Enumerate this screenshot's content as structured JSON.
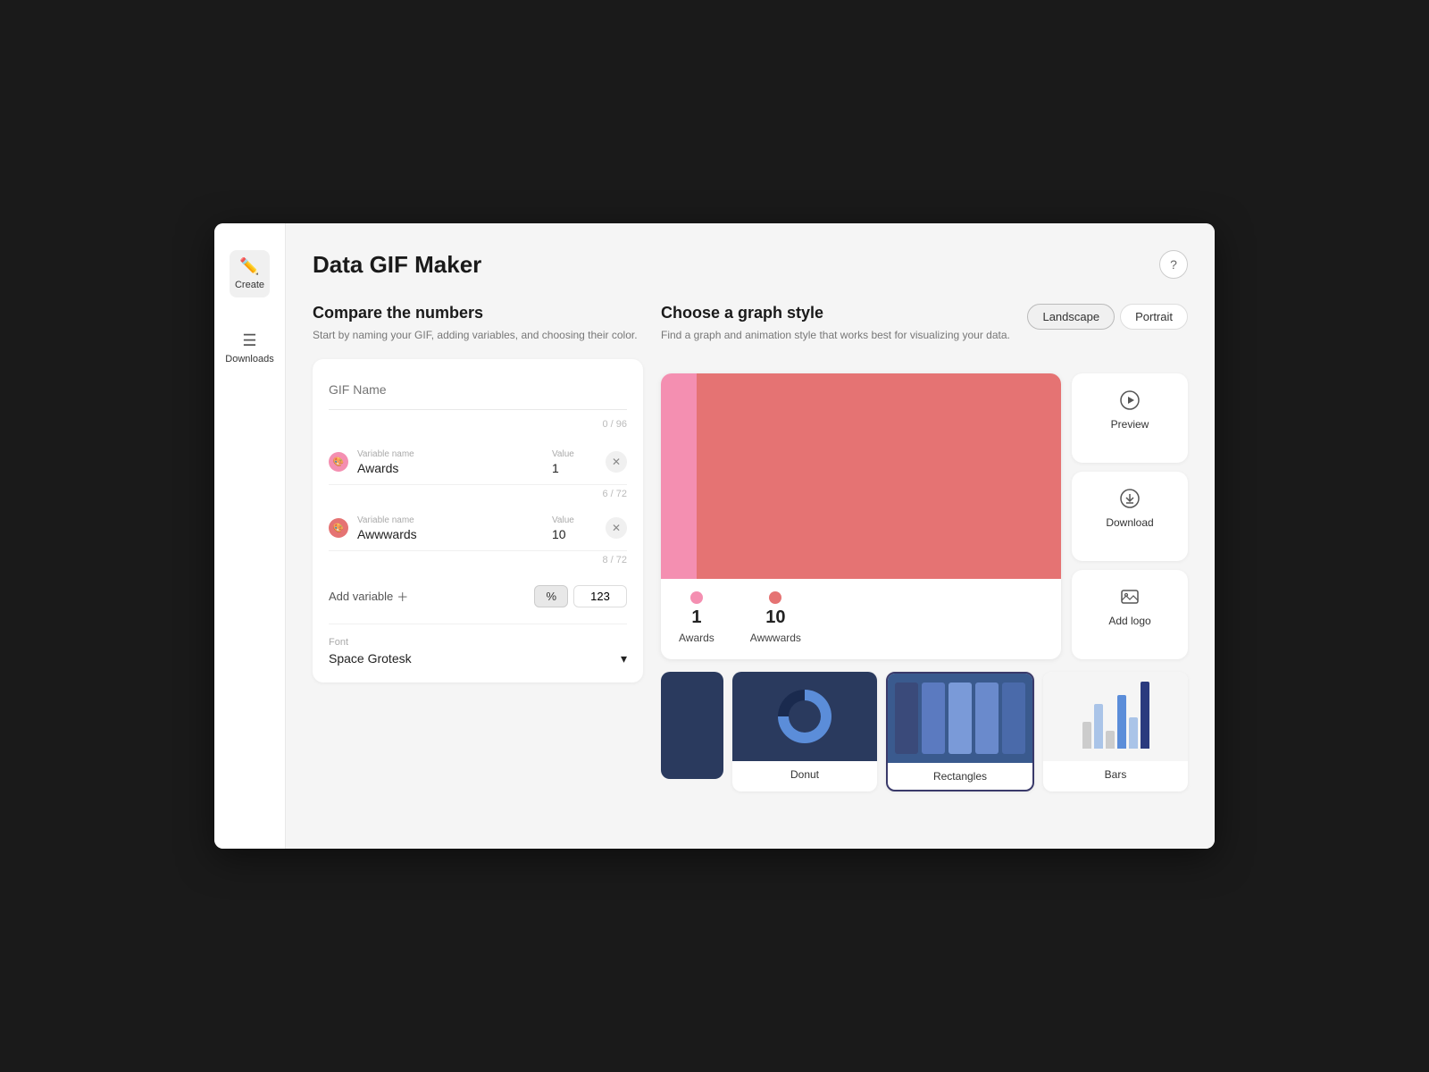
{
  "app": {
    "title": "Data GIF Maker",
    "help_icon": "?"
  },
  "sidebar": {
    "items": [
      {
        "id": "create",
        "label": "Create",
        "icon": "✏️",
        "active": true
      },
      {
        "id": "downloads",
        "label": "Downloads",
        "icon": "☰",
        "active": false
      }
    ]
  },
  "left_panel": {
    "title": "Compare the numbers",
    "subtitle": "Start by naming your GIF, adding variables, and choosing their color.",
    "gif_name_placeholder": "GIF Name",
    "char_count": "0 / 96",
    "variables": [
      {
        "id": "v1",
        "color": "pink",
        "name_label": "Variable name",
        "name_value": "Awards",
        "value_label": "Value",
        "value": "1",
        "char_count": "6 / 72"
      },
      {
        "id": "v2",
        "color": "red",
        "name_label": "Variable name",
        "name_value": "Awwwards",
        "value_label": "Value",
        "value": "10",
        "char_count": "8 / 72"
      }
    ],
    "add_variable_label": "Add variable",
    "format_percent": "%",
    "format_value": "123",
    "font_label": "Font",
    "font_value": "Space Grotesk"
  },
  "right_panel": {
    "title": "Choose a graph style",
    "subtitle": "Find a graph and animation style that works best for visualizing your data.",
    "orientation": {
      "landscape": "Landscape",
      "portrait": "Portrait",
      "active": "landscape"
    },
    "graph_preview": {
      "bar1_label": "1",
      "bar1_name": "Awards",
      "bar2_label": "10",
      "bar2_name": "Awwwards"
    },
    "actions": [
      {
        "id": "preview",
        "icon": "▶",
        "label": "Preview"
      },
      {
        "id": "download",
        "icon": "⬇",
        "label": "Download"
      },
      {
        "id": "add-logo",
        "icon": "🖼",
        "label": "Add logo"
      }
    ],
    "graph_styles": [
      {
        "id": "partial",
        "label": "",
        "active": false
      },
      {
        "id": "donut",
        "label": "Donut",
        "active": false
      },
      {
        "id": "rectangles",
        "label": "Rectangles",
        "active": true
      },
      {
        "id": "bars",
        "label": "Bars",
        "active": false
      }
    ]
  },
  "colors": {
    "pink": "#f48fb1",
    "red": "#e57373",
    "dark_blue": "#2a3a5e",
    "mid_blue": "#3a5a8e",
    "accent_blue": "#5b8dd9"
  }
}
